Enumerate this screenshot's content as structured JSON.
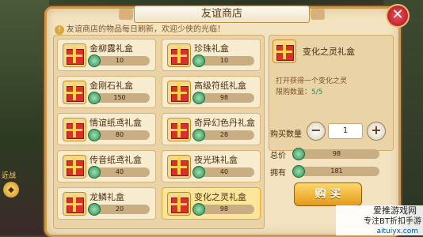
{
  "title": "友谊商店",
  "notice": "友谊商店的物品每日刷新，欢迎少侠的光临！",
  "items": [
    {
      "name": "金柳露礼盒",
      "price": "10",
      "selected": false
    },
    {
      "name": "珍珠礼盒",
      "price": "10",
      "selected": false
    },
    {
      "name": "金刚石礼盒",
      "price": "150",
      "selected": false
    },
    {
      "name": "高级符纸礼盒",
      "price": "98",
      "selected": false
    },
    {
      "name": "情谊纸鸢礼盒",
      "price": "80",
      "selected": false
    },
    {
      "name": "奇异幻色丹礼盒",
      "price": "28",
      "selected": false
    },
    {
      "name": "传音纸鸢礼盒",
      "price": "40",
      "selected": false
    },
    {
      "name": "夜光珠礼盒",
      "price": "40",
      "selected": false
    },
    {
      "name": "龙鳞礼盒",
      "price": "20",
      "selected": false
    },
    {
      "name": "变化之灵礼盒",
      "price": "98",
      "selected": true
    }
  ],
  "detail": {
    "name": "变化之灵礼盒",
    "desc": "打开获得一个变化之灵",
    "limit_label": "限购数量：",
    "limit_value": "5/5"
  },
  "purchase": {
    "qty_label": "购买数量",
    "qty_value": "1",
    "minus": "−",
    "plus": "+",
    "total_label": "总价",
    "total_value": "98",
    "owned_label": "拥有",
    "owned_value": "181",
    "buy_label": "购 买"
  },
  "close_glyph": "✕",
  "side_label": "近战",
  "watermark": {
    "line1": "爱推游戏网",
    "line2": "专注BT折扣手游",
    "line3": "aituiyx.com"
  }
}
